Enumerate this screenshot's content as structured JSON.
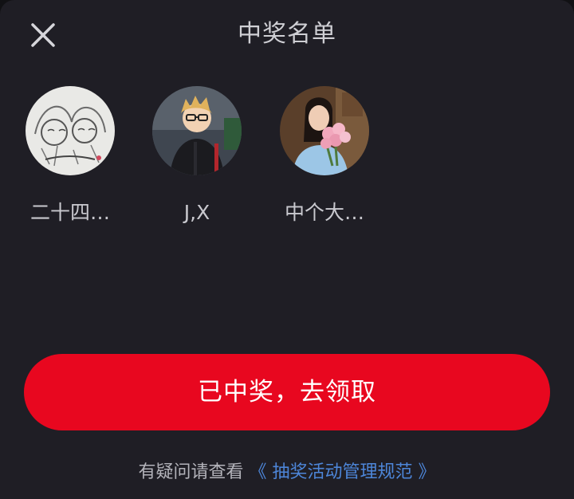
{
  "header": {
    "title": "中奖名单"
  },
  "winners": [
    {
      "name": "二十四…",
      "avatar": "sketch-drawing-avatar"
    },
    {
      "name": "J,X",
      "avatar": "anime-character-avatar"
    },
    {
      "name": "中个大…",
      "avatar": "person-with-flowers-avatar"
    }
  ],
  "action": {
    "claim_label": "已中奖，去领取"
  },
  "footer": {
    "prefix": "有疑问请查看",
    "link_label": "《 抽奖活动管理规范 》"
  },
  "colors": {
    "background": "#1f1e25",
    "button": "#e8071f",
    "link": "#4d86d9"
  }
}
